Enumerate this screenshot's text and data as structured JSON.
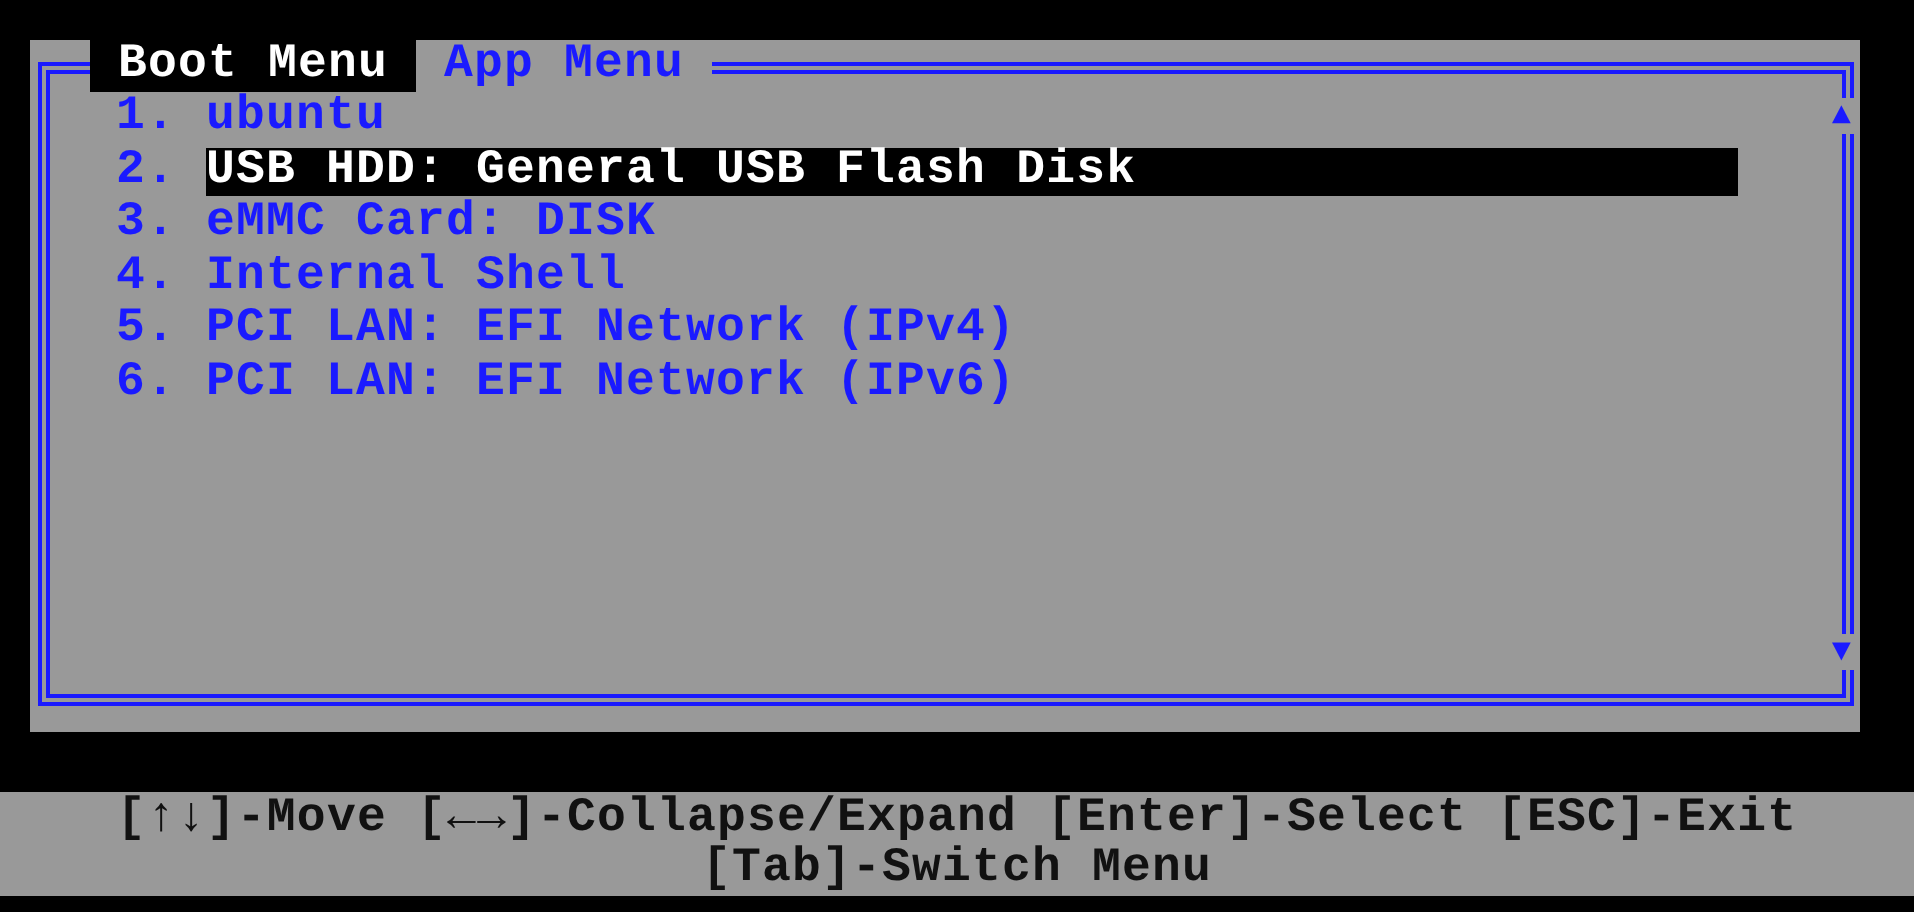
{
  "tabs": [
    {
      "label": "Boot Menu",
      "selected": true
    },
    {
      "label": "App Menu",
      "selected": false
    }
  ],
  "boot_entries": [
    {
      "number": "1.",
      "label": "ubuntu",
      "selected": false
    },
    {
      "number": "2.",
      "label": "USB HDD: General USB Flash Disk",
      "selected": true
    },
    {
      "number": "3.",
      "label": "eMMC Card: DISK",
      "selected": false
    },
    {
      "number": "4.",
      "label": "Internal Shell",
      "selected": false
    },
    {
      "number": "5.",
      "label": "PCI LAN: EFI Network (IPv4)",
      "selected": false
    },
    {
      "number": "6.",
      "label": "PCI LAN: EFI Network (IPv6)",
      "selected": false
    }
  ],
  "scroll_arrows": [
    "▲",
    "▼"
  ],
  "help_bar": {
    "lines": [
      {
        "hints": [
          "[↑↓]-Move",
          "[←→]-Collapse/Expand",
          "[Enter]-Select",
          "[ESC]-Exit"
        ]
      },
      {
        "hints": [
          "[Tab]-Switch Menu"
        ]
      }
    ]
  }
}
